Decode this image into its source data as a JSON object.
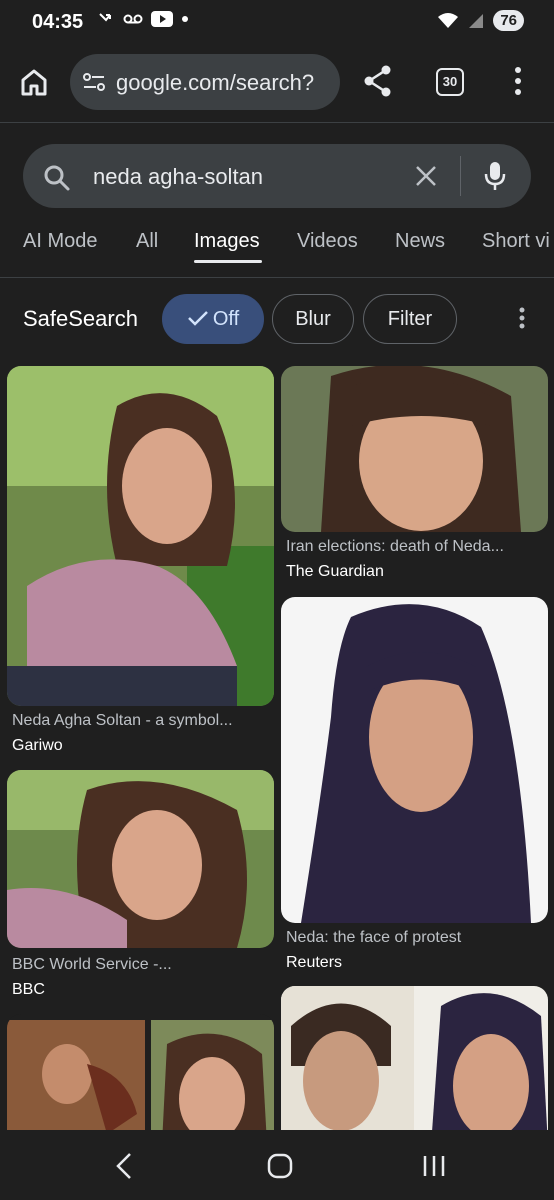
{
  "status": {
    "time": "04:35",
    "battery": "76"
  },
  "toolbar": {
    "url": "google.com/search?",
    "tab_count": "30"
  },
  "search": {
    "query": "neda agha-soltan"
  },
  "tabs": [
    {
      "label": "AI Mode"
    },
    {
      "label": "All"
    },
    {
      "label": "Images"
    },
    {
      "label": "Videos"
    },
    {
      "label": "News"
    },
    {
      "label": "Short vi"
    }
  ],
  "filters": {
    "safesearch_label": "SafeSearch",
    "chips": [
      {
        "label": "Off",
        "selected": true
      },
      {
        "label": "Blur"
      },
      {
        "label": "Filter"
      }
    ]
  },
  "results": [
    {
      "caption": "Neda Agha Soltan - a symbol...",
      "source": "Gariwo"
    },
    {
      "caption": "Iran elections: death of Neda...",
      "source": "The Guardian"
    },
    {
      "caption": "BBC World Service -...",
      "source": "BBC"
    },
    {
      "caption": "Neda: the face of protest",
      "source": "Reuters"
    }
  ],
  "colors": {
    "background": "#1f1f1f",
    "chip_selected": "#394f7b",
    "text_primary": "#e8eaed"
  }
}
